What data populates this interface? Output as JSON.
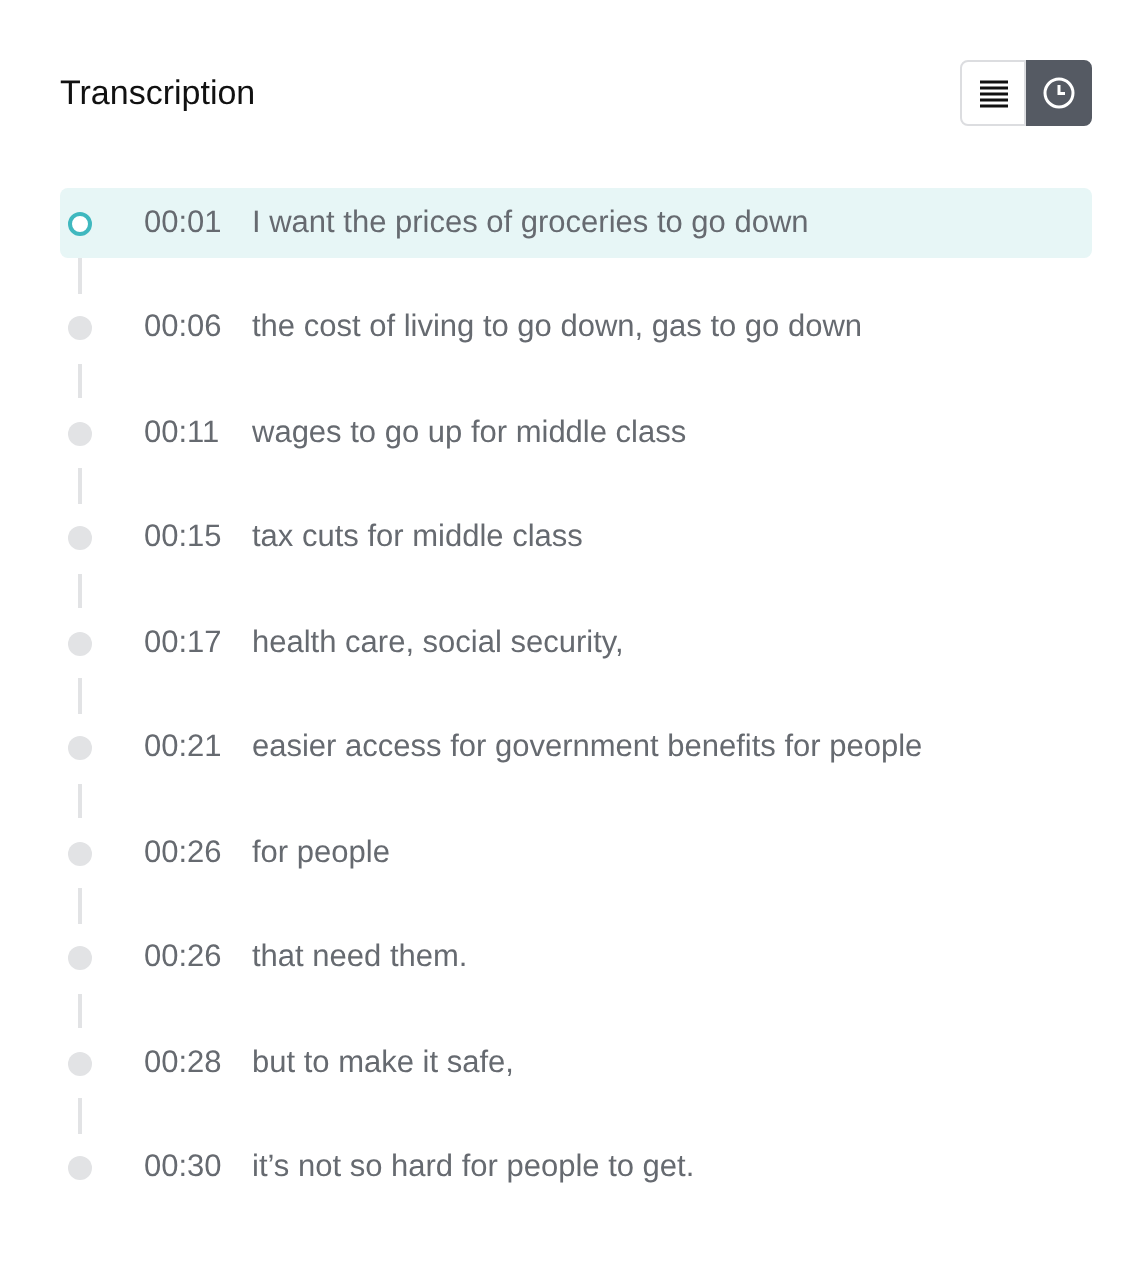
{
  "header": {
    "title": "Transcription"
  },
  "view_toggle": [
    {
      "kind": "list",
      "selected": false
    },
    {
      "kind": "timeline",
      "selected": true
    }
  ],
  "entries": [
    {
      "time": "00:01",
      "text": "I want the prices of groceries to go down",
      "selected": true
    },
    {
      "time": "00:06",
      "text": "the cost of living to go down, gas to go down",
      "selected": false
    },
    {
      "time": "00:11",
      "text": "wages to go up for middle class",
      "selected": false
    },
    {
      "time": "00:15",
      "text": "tax cuts for middle class",
      "selected": false
    },
    {
      "time": "00:17",
      "text": "health care, social security,",
      "selected": false
    },
    {
      "time": "00:21",
      "text": "easier access for government benefits for people",
      "selected": false
    },
    {
      "time": "00:26",
      "text": "for people",
      "selected": false
    },
    {
      "time": "00:26",
      "text": "that need them.",
      "selected": false
    },
    {
      "time": "00:28",
      "text": "but to make it safe,",
      "selected": false
    },
    {
      "time": "00:30",
      "text": "it’s not so hard for people to get.",
      "selected": false
    }
  ]
}
